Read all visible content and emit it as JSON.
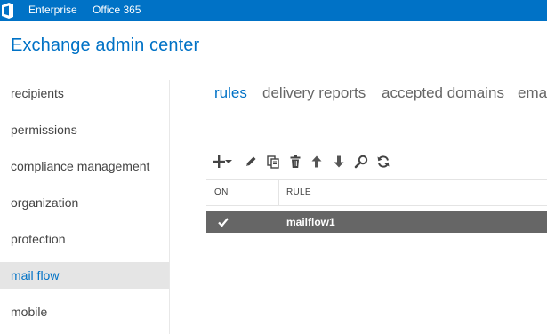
{
  "topbar": {
    "enterprise": "Enterprise",
    "office365": "Office 365",
    "bg_color": "#0072c6"
  },
  "app": {
    "title": "Exchange admin center"
  },
  "nav": {
    "items": [
      {
        "label": "recipients"
      },
      {
        "label": "permissions"
      },
      {
        "label": "compliance management"
      },
      {
        "label": "organization"
      },
      {
        "label": "protection"
      },
      {
        "label": "mail flow",
        "selected": true
      },
      {
        "label": "mobile"
      }
    ]
  },
  "tabs": [
    {
      "label": "rules",
      "active": true
    },
    {
      "label": "delivery reports"
    },
    {
      "label": "accepted domains"
    },
    {
      "label": "ema"
    }
  ],
  "toolbar": {
    "icons": [
      "add-icon",
      "dropdown-arrow-icon",
      "edit-icon",
      "copy-icon",
      "delete-icon",
      "move-up-icon",
      "move-down-icon",
      "search-icon",
      "refresh-icon"
    ]
  },
  "grid": {
    "columns": {
      "on": "ON",
      "rule": "RULE"
    },
    "rows": [
      {
        "on": true,
        "rule": "mailflow1",
        "selected": true
      }
    ]
  },
  "colors": {
    "accent": "#0072c6",
    "selected_row": "#666666",
    "selected_nav": "#e5e5e5"
  }
}
